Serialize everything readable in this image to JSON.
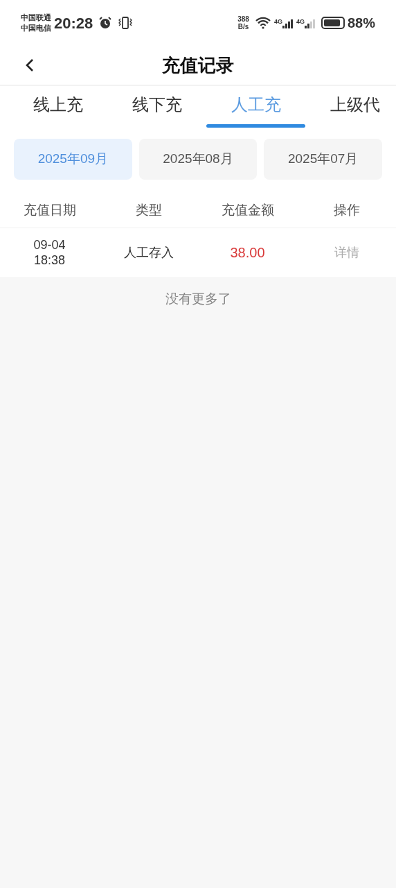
{
  "status_bar": {
    "carriers": [
      "中国联通",
      "中国电信"
    ],
    "time": "20:28",
    "speed_value": "388",
    "speed_unit": "B/s",
    "network_labels": [
      "4G",
      "4G"
    ],
    "battery_text": "88%"
  },
  "header": {
    "title": "充值记录"
  },
  "tabs": [
    {
      "label": "线上充",
      "selected": false
    },
    {
      "label": "线下充",
      "selected": false
    },
    {
      "label": "人工充",
      "selected": true
    },
    {
      "label": "上级代",
      "selected": false
    }
  ],
  "months": [
    {
      "label": "2025年09月",
      "selected": true
    },
    {
      "label": "2025年08月",
      "selected": false
    },
    {
      "label": "2025年07月",
      "selected": false
    }
  ],
  "table": {
    "columns": [
      "充值日期",
      "类型",
      "充值金额",
      "操作"
    ],
    "rows": [
      {
        "date": "09-04",
        "time": "18:38",
        "type": "人工存入",
        "amount": "38.00",
        "action": "详情"
      }
    ]
  },
  "footer_note": "没有更多了"
}
